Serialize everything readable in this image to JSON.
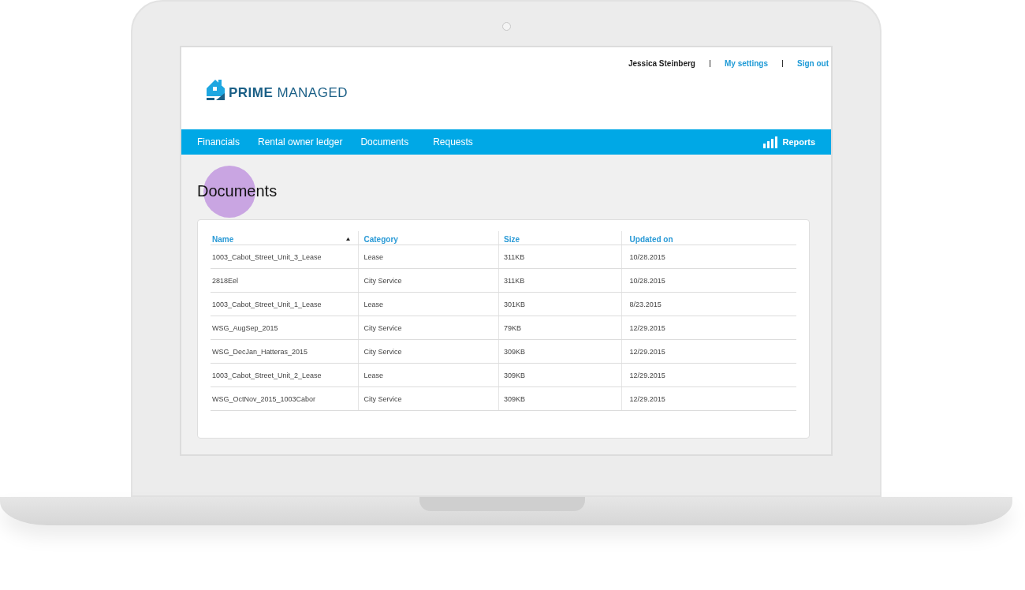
{
  "header": {
    "logo": {
      "bold": "PRIME",
      "light": "MANAGED"
    },
    "user": "Jessica Steinberg",
    "links": [
      "My settings",
      "Sign out"
    ]
  },
  "nav": {
    "items": [
      "Financials",
      "Rental owner ledger",
      "Documents",
      "Requests"
    ],
    "reports": "Reports"
  },
  "page_title": "Documents",
  "table": {
    "columns": [
      "Name",
      "Category",
      "Size",
      "Updated on"
    ],
    "rows": [
      [
        "1003_Cabot_Street_Unit_3_Lease",
        "Lease",
        "311KB",
        "10/28.2015"
      ],
      [
        "2818Eel",
        "City Service",
        "311KB",
        "10/28.2015"
      ],
      [
        "1003_Cabot_Street_Unit_1_Lease",
        "Lease",
        "301KB",
        "8/23.2015"
      ],
      [
        "WSG_AugSep_2015",
        "City Service",
        "79KB",
        "12/29.2015"
      ],
      [
        "WSG_DecJan_Hatteras_2015",
        "City Service",
        "309KB",
        "12/29.2015"
      ],
      [
        "1003_Cabot_Street_Unit_2_Lease",
        "Lease",
        "309KB",
        "12/29.2015"
      ],
      [
        "WSG_OctNov_2015_1003Cabor",
        "City Service",
        "309KB",
        "12/29.2015"
      ]
    ]
  }
}
